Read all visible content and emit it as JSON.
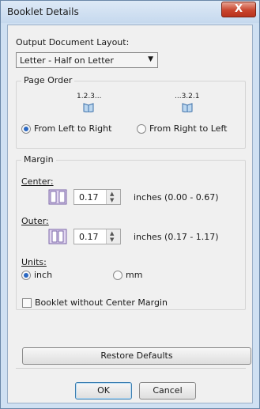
{
  "window": {
    "title": "Booklet Details",
    "close_glyph": "X"
  },
  "layout_section": {
    "label": "Output Document Layout:",
    "selected": "Letter - Half on Letter",
    "dropdown_arrow": "▼"
  },
  "page_order": {
    "title": "Page Order",
    "left_icon_caption": "1.2.3...",
    "right_icon_caption": "...3.2.1",
    "left_radio_label": "From Left to Right",
    "right_radio_label": "From Right to Left",
    "selected": "left"
  },
  "margin": {
    "title": "Margin",
    "center_label": "Center:",
    "center_value": "0.17",
    "center_range": "inches (0.00 - 0.67)",
    "outer_label": "Outer:",
    "outer_value": "0.17",
    "outer_range": "inches (0.17 - 1.17)",
    "units_label": "Units:",
    "unit_inch": "inch",
    "unit_mm": "mm",
    "selected_unit": "inch"
  },
  "options": {
    "no_center_margin_label": "Booklet without Center Margin",
    "no_center_margin_checked": false
  },
  "buttons": {
    "restore": "Restore Defaults",
    "ok": "OK",
    "cancel": "Cancel"
  }
}
